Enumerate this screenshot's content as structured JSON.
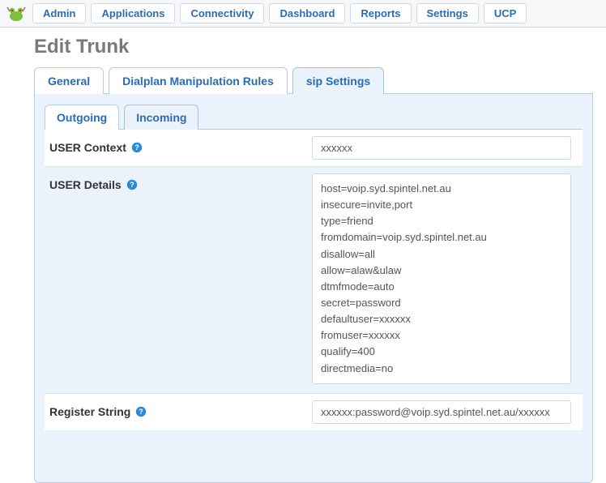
{
  "nav": {
    "items": [
      "Admin",
      "Applications",
      "Connectivity",
      "Dashboard",
      "Reports",
      "Settings",
      "UCP"
    ]
  },
  "title": "Edit Trunk",
  "tabs_outer": {
    "items": [
      "General",
      "Dialplan Manipulation Rules",
      "sip Settings"
    ],
    "active": 2
  },
  "tabs_inner": {
    "items": [
      "Outgoing",
      "Incoming"
    ],
    "active": 1
  },
  "form": {
    "user_context": {
      "label": "USER Context",
      "value": "xxxxxx"
    },
    "user_details": {
      "label": "USER Details",
      "value": "host=voip.syd.spintel.net.au\ninsecure=invite,port\ntype=friend\nfromdomain=voip.syd.spintel.net.au\ndisallow=all\nallow=alaw&ulaw\ndtmfmode=auto\nsecret=password\ndefaultuser=xxxxxx\nfromuser=xxxxxx\nqualify=400\ndirectmedia=no"
    },
    "register_string": {
      "label": "Register String",
      "value": "xxxxxx:password@voip.syd.spintel.net.au/xxxxxx"
    }
  }
}
